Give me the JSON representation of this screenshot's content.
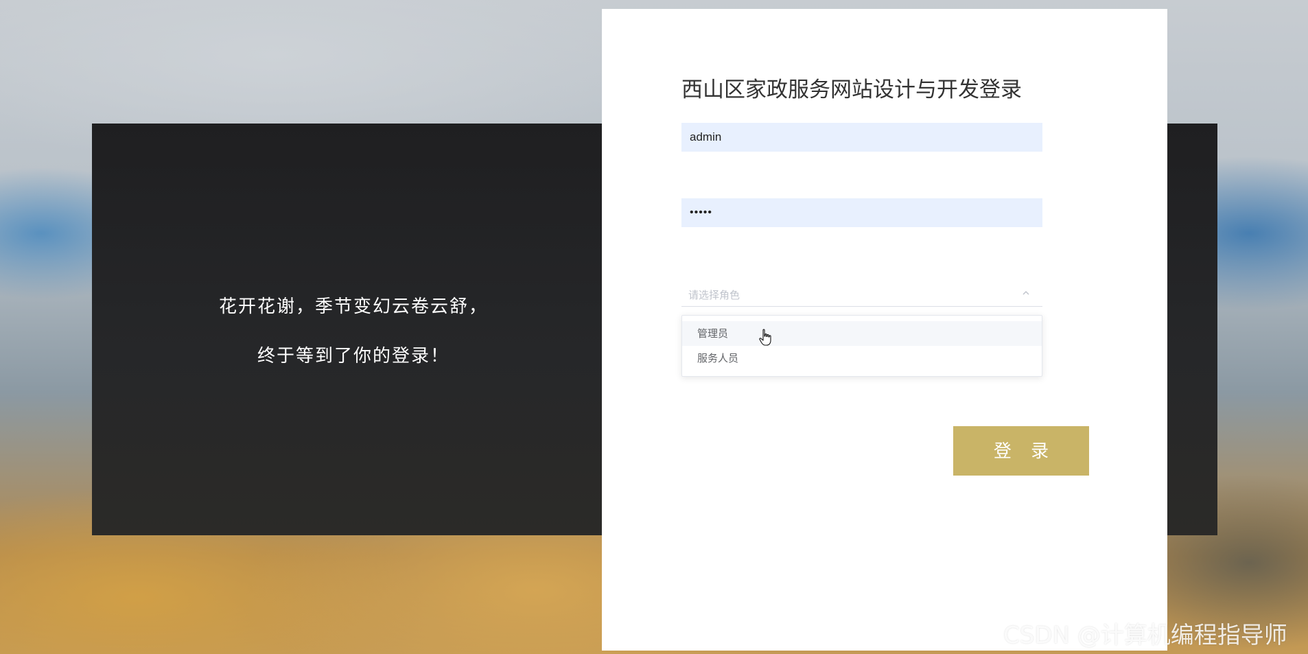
{
  "slogan": {
    "line1": "花开花谢，季节变幻云卷云舒，",
    "line2": "终于等到了你的登录！"
  },
  "login": {
    "title": "西山区家政服务网站设计与开发登录",
    "username_value": "admin",
    "password_value": "•••••",
    "role_placeholder": "请选择角色",
    "role_options": [
      "管理员",
      "服务人员"
    ],
    "submit_label": "登 录"
  },
  "colors": {
    "button": "#c9b467",
    "input_bg": "#e8f0fe"
  },
  "watermark": "CSDN @计算机编程指导师",
  "icons": {
    "select_arrow": "chevron-up-icon",
    "pointer": "hand-cursor-icon"
  }
}
